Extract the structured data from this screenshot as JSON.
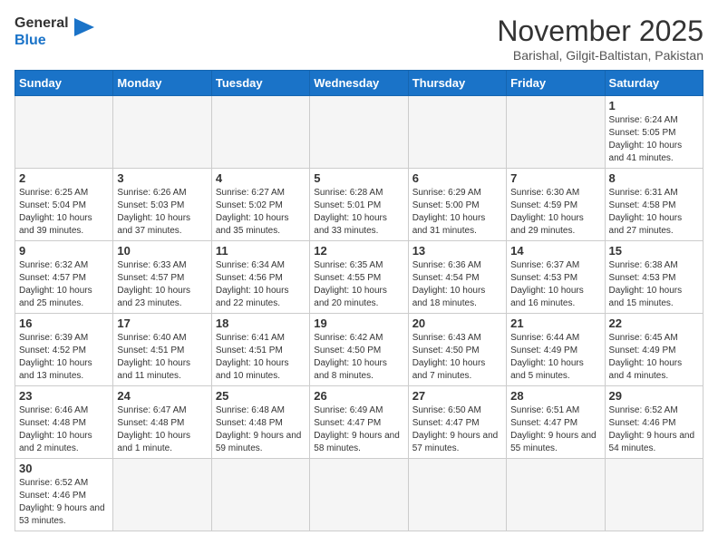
{
  "logo": {
    "text_general": "General",
    "text_blue": "Blue"
  },
  "title": "November 2025",
  "subtitle": "Barishal, Gilgit-Baltistan, Pakistan",
  "days_of_week": [
    "Sunday",
    "Monday",
    "Tuesday",
    "Wednesday",
    "Thursday",
    "Friday",
    "Saturday"
  ],
  "weeks": [
    [
      {
        "day": "",
        "info": ""
      },
      {
        "day": "",
        "info": ""
      },
      {
        "day": "",
        "info": ""
      },
      {
        "day": "",
        "info": ""
      },
      {
        "day": "",
        "info": ""
      },
      {
        "day": "",
        "info": ""
      },
      {
        "day": "1",
        "info": "Sunrise: 6:24 AM\nSunset: 5:05 PM\nDaylight: 10 hours and 41 minutes."
      }
    ],
    [
      {
        "day": "2",
        "info": "Sunrise: 6:25 AM\nSunset: 5:04 PM\nDaylight: 10 hours and 39 minutes."
      },
      {
        "day": "3",
        "info": "Sunrise: 6:26 AM\nSunset: 5:03 PM\nDaylight: 10 hours and 37 minutes."
      },
      {
        "day": "4",
        "info": "Sunrise: 6:27 AM\nSunset: 5:02 PM\nDaylight: 10 hours and 35 minutes."
      },
      {
        "day": "5",
        "info": "Sunrise: 6:28 AM\nSunset: 5:01 PM\nDaylight: 10 hours and 33 minutes."
      },
      {
        "day": "6",
        "info": "Sunrise: 6:29 AM\nSunset: 5:00 PM\nDaylight: 10 hours and 31 minutes."
      },
      {
        "day": "7",
        "info": "Sunrise: 6:30 AM\nSunset: 4:59 PM\nDaylight: 10 hours and 29 minutes."
      },
      {
        "day": "8",
        "info": "Sunrise: 6:31 AM\nSunset: 4:58 PM\nDaylight: 10 hours and 27 minutes."
      }
    ],
    [
      {
        "day": "9",
        "info": "Sunrise: 6:32 AM\nSunset: 4:57 PM\nDaylight: 10 hours and 25 minutes."
      },
      {
        "day": "10",
        "info": "Sunrise: 6:33 AM\nSunset: 4:57 PM\nDaylight: 10 hours and 23 minutes."
      },
      {
        "day": "11",
        "info": "Sunrise: 6:34 AM\nSunset: 4:56 PM\nDaylight: 10 hours and 22 minutes."
      },
      {
        "day": "12",
        "info": "Sunrise: 6:35 AM\nSunset: 4:55 PM\nDaylight: 10 hours and 20 minutes."
      },
      {
        "day": "13",
        "info": "Sunrise: 6:36 AM\nSunset: 4:54 PM\nDaylight: 10 hours and 18 minutes."
      },
      {
        "day": "14",
        "info": "Sunrise: 6:37 AM\nSunset: 4:53 PM\nDaylight: 10 hours and 16 minutes."
      },
      {
        "day": "15",
        "info": "Sunrise: 6:38 AM\nSunset: 4:53 PM\nDaylight: 10 hours and 15 minutes."
      }
    ],
    [
      {
        "day": "16",
        "info": "Sunrise: 6:39 AM\nSunset: 4:52 PM\nDaylight: 10 hours and 13 minutes."
      },
      {
        "day": "17",
        "info": "Sunrise: 6:40 AM\nSunset: 4:51 PM\nDaylight: 10 hours and 11 minutes."
      },
      {
        "day": "18",
        "info": "Sunrise: 6:41 AM\nSunset: 4:51 PM\nDaylight: 10 hours and 10 minutes."
      },
      {
        "day": "19",
        "info": "Sunrise: 6:42 AM\nSunset: 4:50 PM\nDaylight: 10 hours and 8 minutes."
      },
      {
        "day": "20",
        "info": "Sunrise: 6:43 AM\nSunset: 4:50 PM\nDaylight: 10 hours and 7 minutes."
      },
      {
        "day": "21",
        "info": "Sunrise: 6:44 AM\nSunset: 4:49 PM\nDaylight: 10 hours and 5 minutes."
      },
      {
        "day": "22",
        "info": "Sunrise: 6:45 AM\nSunset: 4:49 PM\nDaylight: 10 hours and 4 minutes."
      }
    ],
    [
      {
        "day": "23",
        "info": "Sunrise: 6:46 AM\nSunset: 4:48 PM\nDaylight: 10 hours and 2 minutes."
      },
      {
        "day": "24",
        "info": "Sunrise: 6:47 AM\nSunset: 4:48 PM\nDaylight: 10 hours and 1 minute."
      },
      {
        "day": "25",
        "info": "Sunrise: 6:48 AM\nSunset: 4:48 PM\nDaylight: 9 hours and 59 minutes."
      },
      {
        "day": "26",
        "info": "Sunrise: 6:49 AM\nSunset: 4:47 PM\nDaylight: 9 hours and 58 minutes."
      },
      {
        "day": "27",
        "info": "Sunrise: 6:50 AM\nSunset: 4:47 PM\nDaylight: 9 hours and 57 minutes."
      },
      {
        "day": "28",
        "info": "Sunrise: 6:51 AM\nSunset: 4:47 PM\nDaylight: 9 hours and 55 minutes."
      },
      {
        "day": "29",
        "info": "Sunrise: 6:52 AM\nSunset: 4:46 PM\nDaylight: 9 hours and 54 minutes."
      }
    ],
    [
      {
        "day": "30",
        "info": "Sunrise: 6:52 AM\nSunset: 4:46 PM\nDaylight: 9 hours and 53 minutes."
      },
      {
        "day": "",
        "info": ""
      },
      {
        "day": "",
        "info": ""
      },
      {
        "day": "",
        "info": ""
      },
      {
        "day": "",
        "info": ""
      },
      {
        "day": "",
        "info": ""
      },
      {
        "day": "",
        "info": ""
      }
    ]
  ]
}
